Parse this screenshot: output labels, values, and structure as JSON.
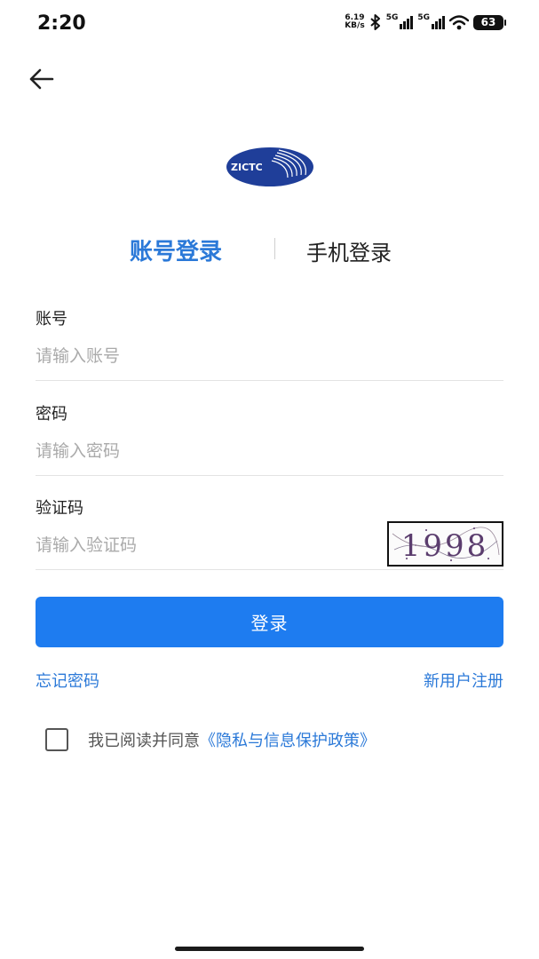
{
  "status_bar": {
    "time": "2:20",
    "net_speed_value": "6.19",
    "net_speed_unit": "KB/s",
    "signal1_tag": "5G",
    "signal2_tag": "5G",
    "battery": "63",
    "icons": [
      "bluetooth-icon",
      "signal-icon",
      "wifi-icon",
      "battery-icon"
    ]
  },
  "header": {
    "back_icon": "arrow-left-icon"
  },
  "logo": {
    "text": "ZICTC"
  },
  "tabs": [
    {
      "label": "账号登录",
      "active": true
    },
    {
      "label": "手机登录",
      "active": false
    }
  ],
  "form": {
    "account": {
      "label": "账号",
      "placeholder": "请输入账号",
      "value": ""
    },
    "password": {
      "label": "密码",
      "placeholder": "请输入密码",
      "value": ""
    },
    "captcha": {
      "label": "验证码",
      "placeholder": "请输入验证码",
      "value": "",
      "image_text": "1998"
    }
  },
  "login_button": {
    "label": "登录"
  },
  "links": {
    "forgot": "忘记密码",
    "register": "新用户注册"
  },
  "agreement": {
    "prefix": "我已阅读并同意",
    "link": "《隐私与信息保护政策》",
    "checked": false
  },
  "colors": {
    "accent": "#1e7cf0",
    "link": "#2b79d8",
    "logo": "#1f3e99"
  }
}
